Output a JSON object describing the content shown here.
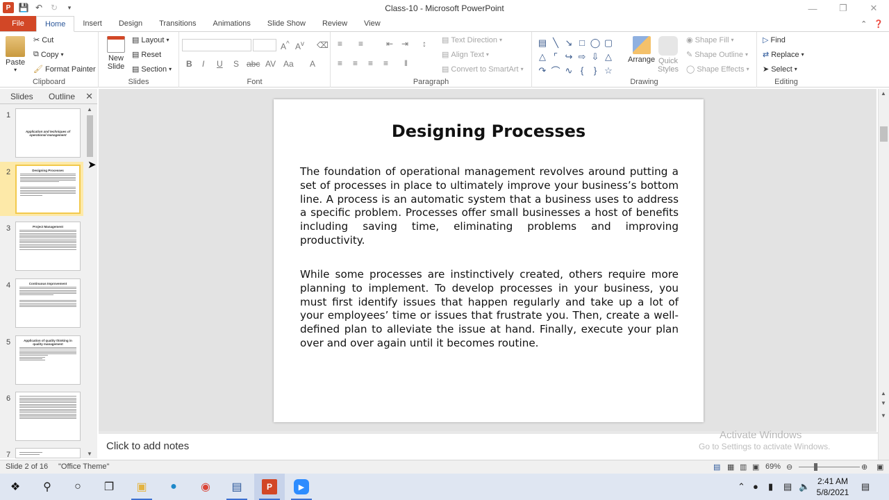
{
  "window": {
    "title": "Class-10  -  Microsoft PowerPoint"
  },
  "tabs": [
    "File",
    "Home",
    "Insert",
    "Design",
    "Transitions",
    "Animations",
    "Slide Show",
    "Review",
    "View"
  ],
  "ribbon": {
    "clipboard": {
      "label": "Clipboard",
      "paste": "Paste",
      "cut": "Cut",
      "copy": "Copy",
      "format_painter": "Format Painter"
    },
    "slides": {
      "label": "Slides",
      "new_slide": "New Slide",
      "layout": "Layout",
      "reset": "Reset",
      "section": "Section"
    },
    "font": {
      "label": "Font"
    },
    "paragraph": {
      "label": "Paragraph",
      "text_direction": "Text Direction",
      "align_text": "Align Text",
      "convert_smartart": "Convert to SmartArt"
    },
    "drawing": {
      "label": "Drawing",
      "arrange": "Arrange",
      "quick_styles": "Quick Styles",
      "shape_fill": "Shape Fill",
      "shape_outline": "Shape Outline",
      "shape_effects": "Shape Effects"
    },
    "editing": {
      "label": "Editing",
      "find": "Find",
      "replace": "Replace",
      "select": "Select"
    }
  },
  "pane": {
    "tab_slides": "Slides",
    "tab_outline": "Outline"
  },
  "thumbnails": [
    {
      "num": "1",
      "title": "Application and techniques of operational management"
    },
    {
      "num": "2",
      "title": "Designing Processes"
    },
    {
      "num": "3",
      "title": "Project Management"
    },
    {
      "num": "4",
      "title": "Continuous Improvement"
    },
    {
      "num": "5",
      "title": "Application of quality thinking in quality management"
    },
    {
      "num": "6",
      "title": ""
    },
    {
      "num": "7",
      "title": ""
    }
  ],
  "slide": {
    "title": "Designing Processes",
    "paragraph1": "The foundation of operational management revolves around putting a set of processes in place to ultimately improve your business’s bottom line. A process is an automatic system that a business uses to address a specific problem. Processes offer small businesses a host of benefits including saving time, eliminating problems and improving productivity.",
    "paragraph2": "While some processes are instinctively created, others require more planning to implement. To develop processes in your business, you must first identify issues that happen regularly and take up a lot of your employees’ time or issues that frustrate you. Then, create a well-defined plan to alleviate the issue at hand. Finally, execute your plan over and over again until it becomes routine."
  },
  "notes": {
    "placeholder": "Click to add notes"
  },
  "watermark": {
    "line1": "Activate Windows",
    "line2": "Go to Settings to activate Windows."
  },
  "status": {
    "slide_info": "Slide 2 of 16",
    "theme": "\"Office Theme\"",
    "zoom": "69%"
  },
  "clock": {
    "time": "2:41 AM",
    "date": "5/8/2021"
  },
  "colors": {
    "file_tab": "#d24726",
    "accent": "#2b579a",
    "selection": "#f2c94c"
  }
}
